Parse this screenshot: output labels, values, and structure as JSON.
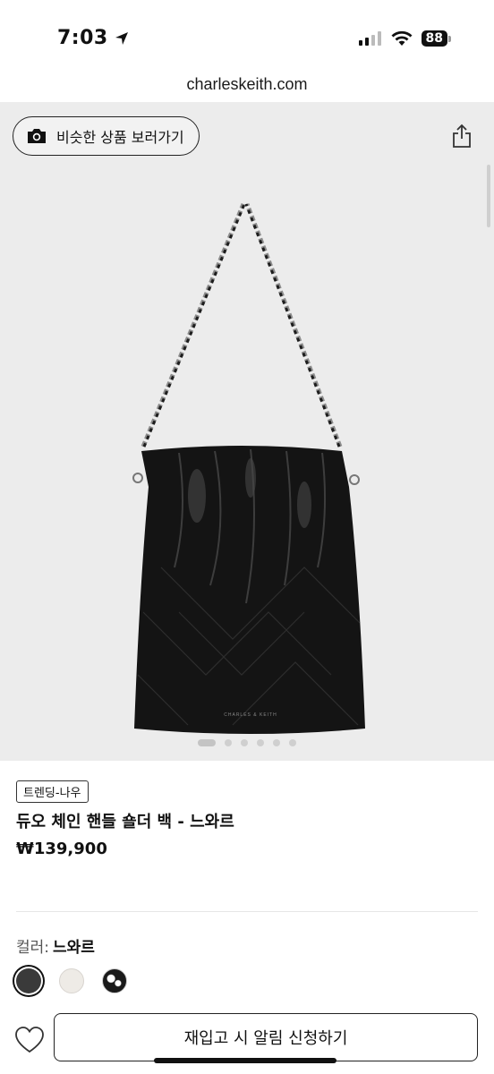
{
  "status": {
    "time": "7:03",
    "battery": "88"
  },
  "browser": {
    "url": "charleskeith.com"
  },
  "gallery": {
    "similar_label": "비슷한 상품 보러가기",
    "slide_count": 6,
    "active_slide": 1,
    "bag_brand": "CHARLES & KEITH"
  },
  "product": {
    "badge": "트렌딩-나우",
    "name": "듀오 체인 핸들 숄더 백 - 느와르",
    "price": "₩139,900",
    "color_label": "컬러:",
    "color_value": "느와르",
    "swatches": [
      "black",
      "cream",
      "pattern"
    ]
  },
  "actions": {
    "restock_label": "재입고 시 알림 신청하기"
  },
  "colors": {
    "gallery_bg": "#ececec",
    "text": "#111111",
    "bag": "#141414"
  }
}
